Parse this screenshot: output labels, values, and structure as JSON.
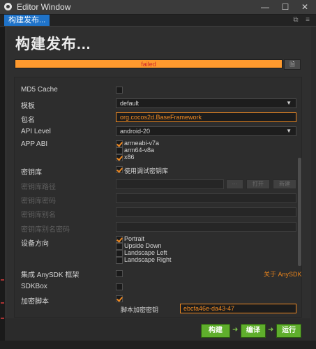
{
  "window": {
    "title": "Editor Window"
  },
  "tabs": [
    {
      "label": "构建发布..."
    }
  ],
  "page": {
    "title": "构建发布..."
  },
  "build_status": {
    "text": "failed",
    "progress": 1.0,
    "bar_color": "#ff9a2e",
    "text_color": "#d02a2a"
  },
  "options": {
    "md5_cache": {
      "label": "MD5 Cache",
      "checked": false
    },
    "template": {
      "label": "模板",
      "value": "default"
    },
    "package": {
      "label": "包名",
      "value": "org.cocos2d.BaseFramework"
    },
    "api_level": {
      "label": "API Level",
      "value": "android-20"
    },
    "app_abi": {
      "label": "APP ABI",
      "items": [
        {
          "label": "armeabi-v7a",
          "checked": true
        },
        {
          "label": "arm64-v8a",
          "checked": false
        },
        {
          "label": "x86",
          "checked": true
        }
      ]
    },
    "keystore": {
      "label": "密钥库",
      "option_label": "使用调试密钥库",
      "checked": true
    },
    "keystore_path": {
      "label": "密钥库路径",
      "btn_dots": "···",
      "btn_open": "打开",
      "btn_new": "新建"
    },
    "keystore_password": {
      "label": "密钥库密码"
    },
    "keystore_alias": {
      "label": "密钥库别名"
    },
    "keystore_alias_password": {
      "label": "密钥库别名密码"
    },
    "orientation": {
      "label": "设备方向",
      "items": [
        {
          "label": "Portrait",
          "checked": true
        },
        {
          "label": "Upside Down",
          "checked": false
        },
        {
          "label": "Landscape Left",
          "checked": false
        },
        {
          "label": "Landscape Right",
          "checked": false
        }
      ]
    },
    "anysdk": {
      "label": "集成 AnySDK 框架",
      "checked": false,
      "link": "关于 AnySDK"
    },
    "sdkbox": {
      "label": "SDKBox",
      "checked": false
    },
    "encrypt": {
      "label": "加密脚本",
      "checked": true,
      "key_label": "脚本加密密钥",
      "key_value": "ebcfa46e-da43-47"
    }
  },
  "footer": {
    "build": "构建",
    "compile": "编译",
    "run": "运行"
  },
  "colors": {
    "accent": "#f08a22",
    "button_green": "#5fae2c",
    "tab_blue": "#1f73c9"
  }
}
